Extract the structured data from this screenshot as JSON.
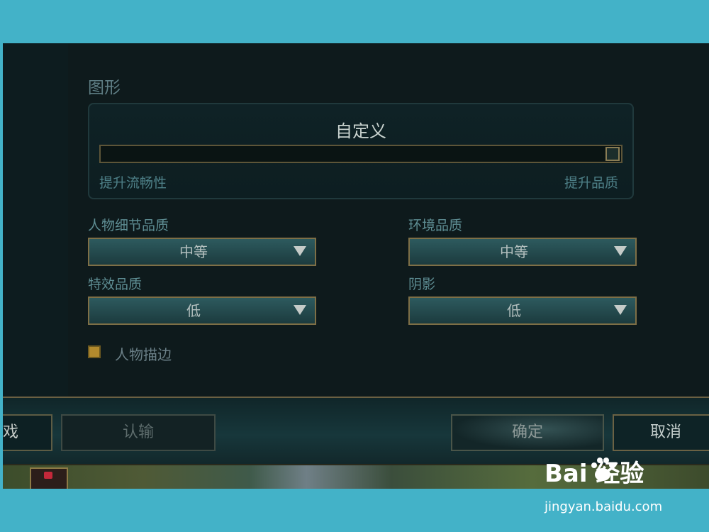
{
  "graphics": {
    "section_title": "图形",
    "preset_name": "自定义",
    "slider": {
      "level": 1.0,
      "left_caption": "提升流畅性",
      "right_caption": "提升品质"
    },
    "fields": [
      {
        "label": "人物细节品质",
        "value": "中等"
      },
      {
        "label": "环境品质",
        "value": "中等"
      },
      {
        "label": "特效品质",
        "value": "低"
      },
      {
        "label": "阴影",
        "value": "低"
      }
    ],
    "checkbox": {
      "label": "人物描边",
      "checked": true
    }
  },
  "footer": {
    "left_partial_label": "戏",
    "surrender_label": "认输",
    "confirm_label": "确定",
    "cancel_label": "取消"
  },
  "watermark": {
    "logo_text": "Bai  经验",
    "url": "jingyan.baidu.com"
  },
  "colors": {
    "frame": "#43b2c8",
    "accent_gold": "#b28a2d",
    "panel_bg": "#0e1a1c"
  }
}
